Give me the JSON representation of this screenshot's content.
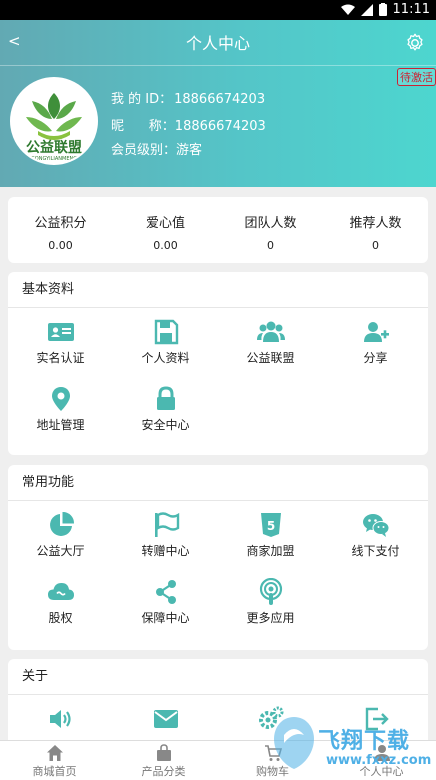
{
  "status_bar": {
    "time": "11:11"
  },
  "header": {
    "back": "<",
    "title": "个人中心"
  },
  "profile": {
    "badge": "待激活",
    "avatar_text": "公益联盟",
    "avatar_subtext": "GONGYILIANMENG",
    "id_label": "我 的 ID：",
    "id_value": "18866674203",
    "nick_label": "昵      称：",
    "nick_value": "18866674203",
    "level_label": "会员级别：",
    "level_value": "游客"
  },
  "stats": [
    {
      "label": "公益积分",
      "value": "0.00"
    },
    {
      "label": "爱心值",
      "value": "0.00"
    },
    {
      "label": "团队人数",
      "value": "0"
    },
    {
      "label": "推荐人数",
      "value": "0"
    }
  ],
  "basic": {
    "title": "基本资料",
    "items": [
      {
        "label": "实名认证",
        "icon": "id-card-icon"
      },
      {
        "label": "个人资料",
        "icon": "save-icon"
      },
      {
        "label": "公益联盟",
        "icon": "users-icon"
      },
      {
        "label": "分享",
        "icon": "user-plus-icon"
      },
      {
        "label": "地址管理",
        "icon": "location-pin-icon"
      },
      {
        "label": "安全中心",
        "icon": "lock-icon"
      }
    ]
  },
  "common": {
    "title": "常用功能",
    "items": [
      {
        "label": "公益大厅",
        "icon": "pie-chart-icon"
      },
      {
        "label": "转赠中心",
        "icon": "flag-icon"
      },
      {
        "label": "商家加盟",
        "icon": "html5-icon"
      },
      {
        "label": "线下支付",
        "icon": "wechat-icon"
      },
      {
        "label": "股权",
        "icon": "cloud-icon"
      },
      {
        "label": "保障中心",
        "icon": "share-icon"
      },
      {
        "label": "更多应用",
        "icon": "podcast-icon"
      }
    ]
  },
  "about": {
    "title": "关于",
    "items": [
      {
        "icon": "speaker-icon"
      },
      {
        "icon": "mail-icon"
      },
      {
        "icon": "gears-icon"
      },
      {
        "icon": "exit-icon"
      }
    ]
  },
  "tabbar": [
    {
      "label": "商城首页",
      "icon": "home-icon"
    },
    {
      "label": "产品分类",
      "icon": "shopping-bag-icon"
    },
    {
      "label": "购物车",
      "icon": "cart-icon"
    },
    {
      "label": "个人中心",
      "icon": "user-icon"
    }
  ],
  "watermark": {
    "text": "飞翔下载",
    "url": "www.fxxz.com"
  },
  "colors": {
    "accent": "#4bb8b0",
    "header_left": "#62a9b3",
    "header_right": "#4dd6cf",
    "badge": "#cc2233"
  }
}
